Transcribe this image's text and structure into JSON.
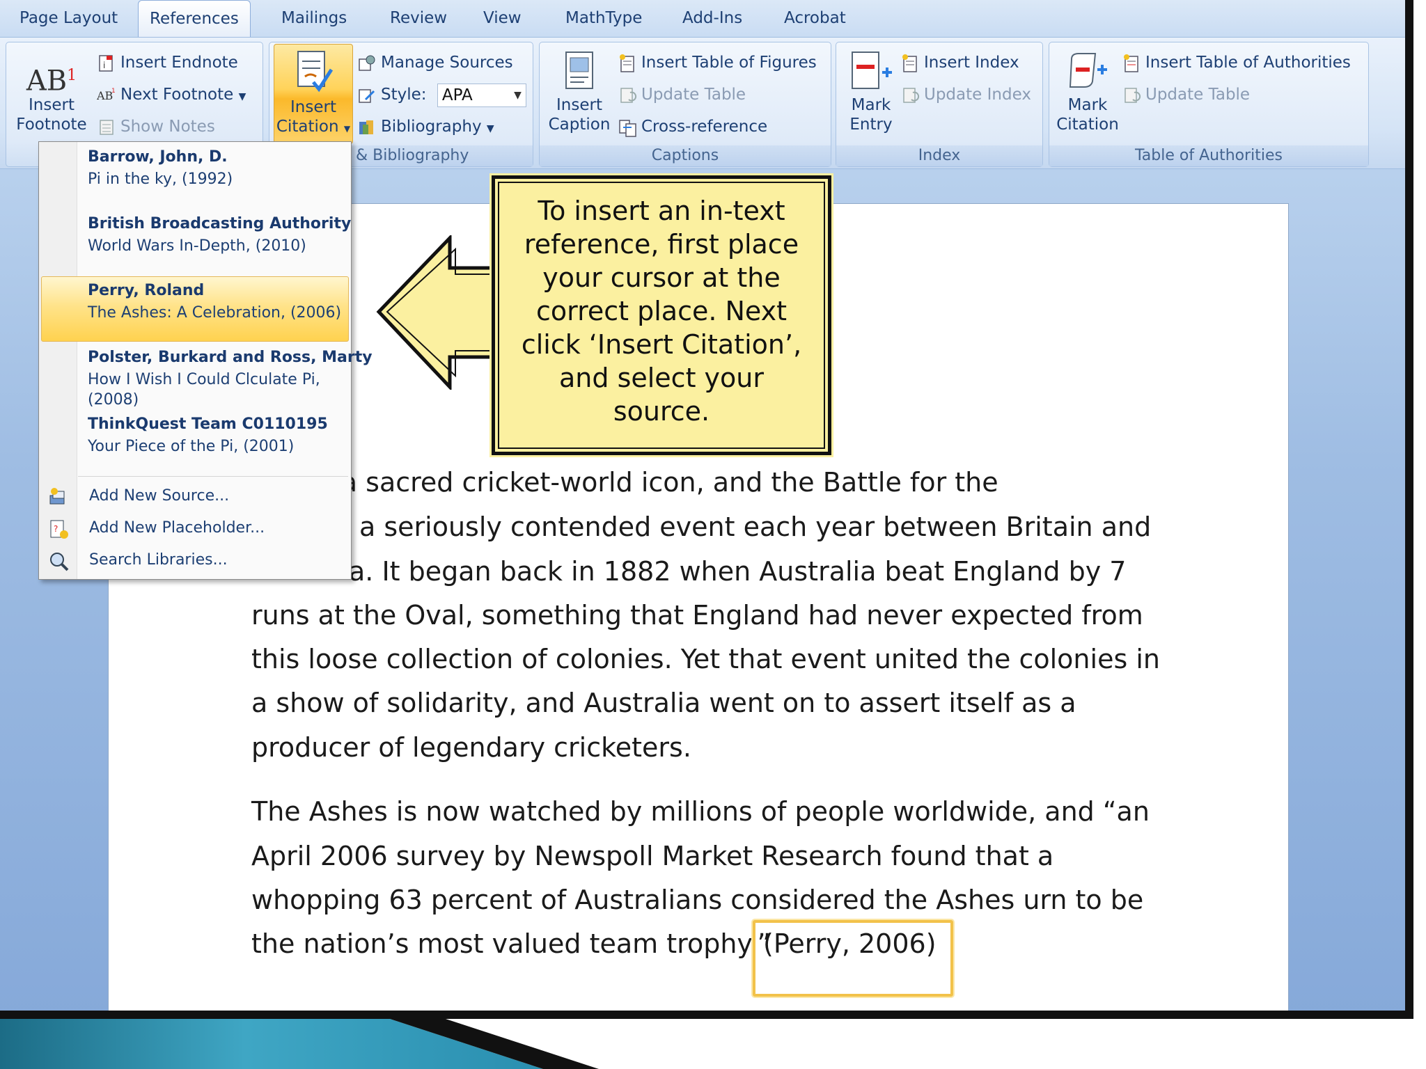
{
  "tabs": [
    {
      "label": "Page Layout"
    },
    {
      "label": "References"
    },
    {
      "label": "Mailings"
    },
    {
      "label": "Review"
    },
    {
      "label": "View"
    },
    {
      "label": "MathType"
    },
    {
      "label": "Add-Ins"
    },
    {
      "label": "Acrobat"
    }
  ],
  "ribbon": {
    "footnotes": {
      "insert_footnote_1": "Insert",
      "insert_footnote_2": "Footnote",
      "insert_endnote": "Insert Endnote",
      "next_footnote": "Next Footnote",
      "show_notes": "Show Notes",
      "ab_glyph": "AB",
      "sup_glyph": "1"
    },
    "citations": {
      "insert_citation_1": "Insert",
      "insert_citation_2": "Citation",
      "manage_sources": "Manage Sources",
      "style_label": "Style:",
      "style_value": "APA",
      "bibliography": "Bibliography",
      "group_label": "ns & Bibliography"
    },
    "captions": {
      "insert_caption_1": "Insert",
      "insert_caption_2": "Caption",
      "insert_table_of_figures": "Insert Table of Figures",
      "update_table": "Update Table",
      "cross_reference": "Cross-reference",
      "group_label": "Captions"
    },
    "index": {
      "mark_entry_1": "Mark",
      "mark_entry_2": "Entry",
      "insert_index": "Insert Index",
      "update_index": "Update Index",
      "group_label": "Index"
    },
    "authorities": {
      "mark_citation_1": "Mark",
      "mark_citation_2": "Citation",
      "insert_table_of_authorities": "Insert Table of Authorities",
      "update_table": "Update Table",
      "group_label": "Table of Authorities"
    }
  },
  "menu": {
    "sources": [
      {
        "author": "Barrow, John, D.",
        "title": "Pi in the ky, (1992)"
      },
      {
        "author": "British Broadcasting Authority",
        "title": "World Wars In-Depth, (2010)"
      },
      {
        "author": "Perry, Roland",
        "title": "The Ashes: A Celebration, (2006)"
      },
      {
        "author": "Polster, Burkard and Ross, Marty",
        "title": "How I Wish I Could Clculate Pi,",
        "title2": "(2008)"
      },
      {
        "author": "ThinkQuest Team C0110195",
        "title": "Your Piece of the Pi, (2001)"
      }
    ],
    "actions": [
      {
        "label": "Add New Source..."
      },
      {
        "label": "Add New Placeholder..."
      },
      {
        "label": "Search Libraries..."
      }
    ]
  },
  "callout": {
    "lines": [
      "To insert an in-text",
      "reference, first place",
      "your cursor at the",
      "correct place. Next",
      "click ‘Insert Citation’,",
      "and select your",
      "source."
    ]
  },
  "document": {
    "para1": [
      "es are a sacred cricket-world icon, and the Battle for the",
      "a seriously contended  event each year between  Britain and",
      "a.  It began back in 1882 when Australia  beat England by 7",
      "runs at the Oval, something that England had never expected  from",
      "this loose collection of colonies. Yet that event united the colonies in",
      "a show of solidarity, and Australia  went on to assert itself as a",
      "producer of legendary  cricketers."
    ],
    "para2": [
      "The Ashes is now watched  by millions of people  worldwide, and “an",
      "April 2006 survey by Newspoll  Market Research  found  that a",
      "whopping 63 percent of Australians considered  the Ashes urn to be",
      "the nation’s most valued team trophy.”"
    ],
    "citation": "(Perry, 2006)"
  }
}
